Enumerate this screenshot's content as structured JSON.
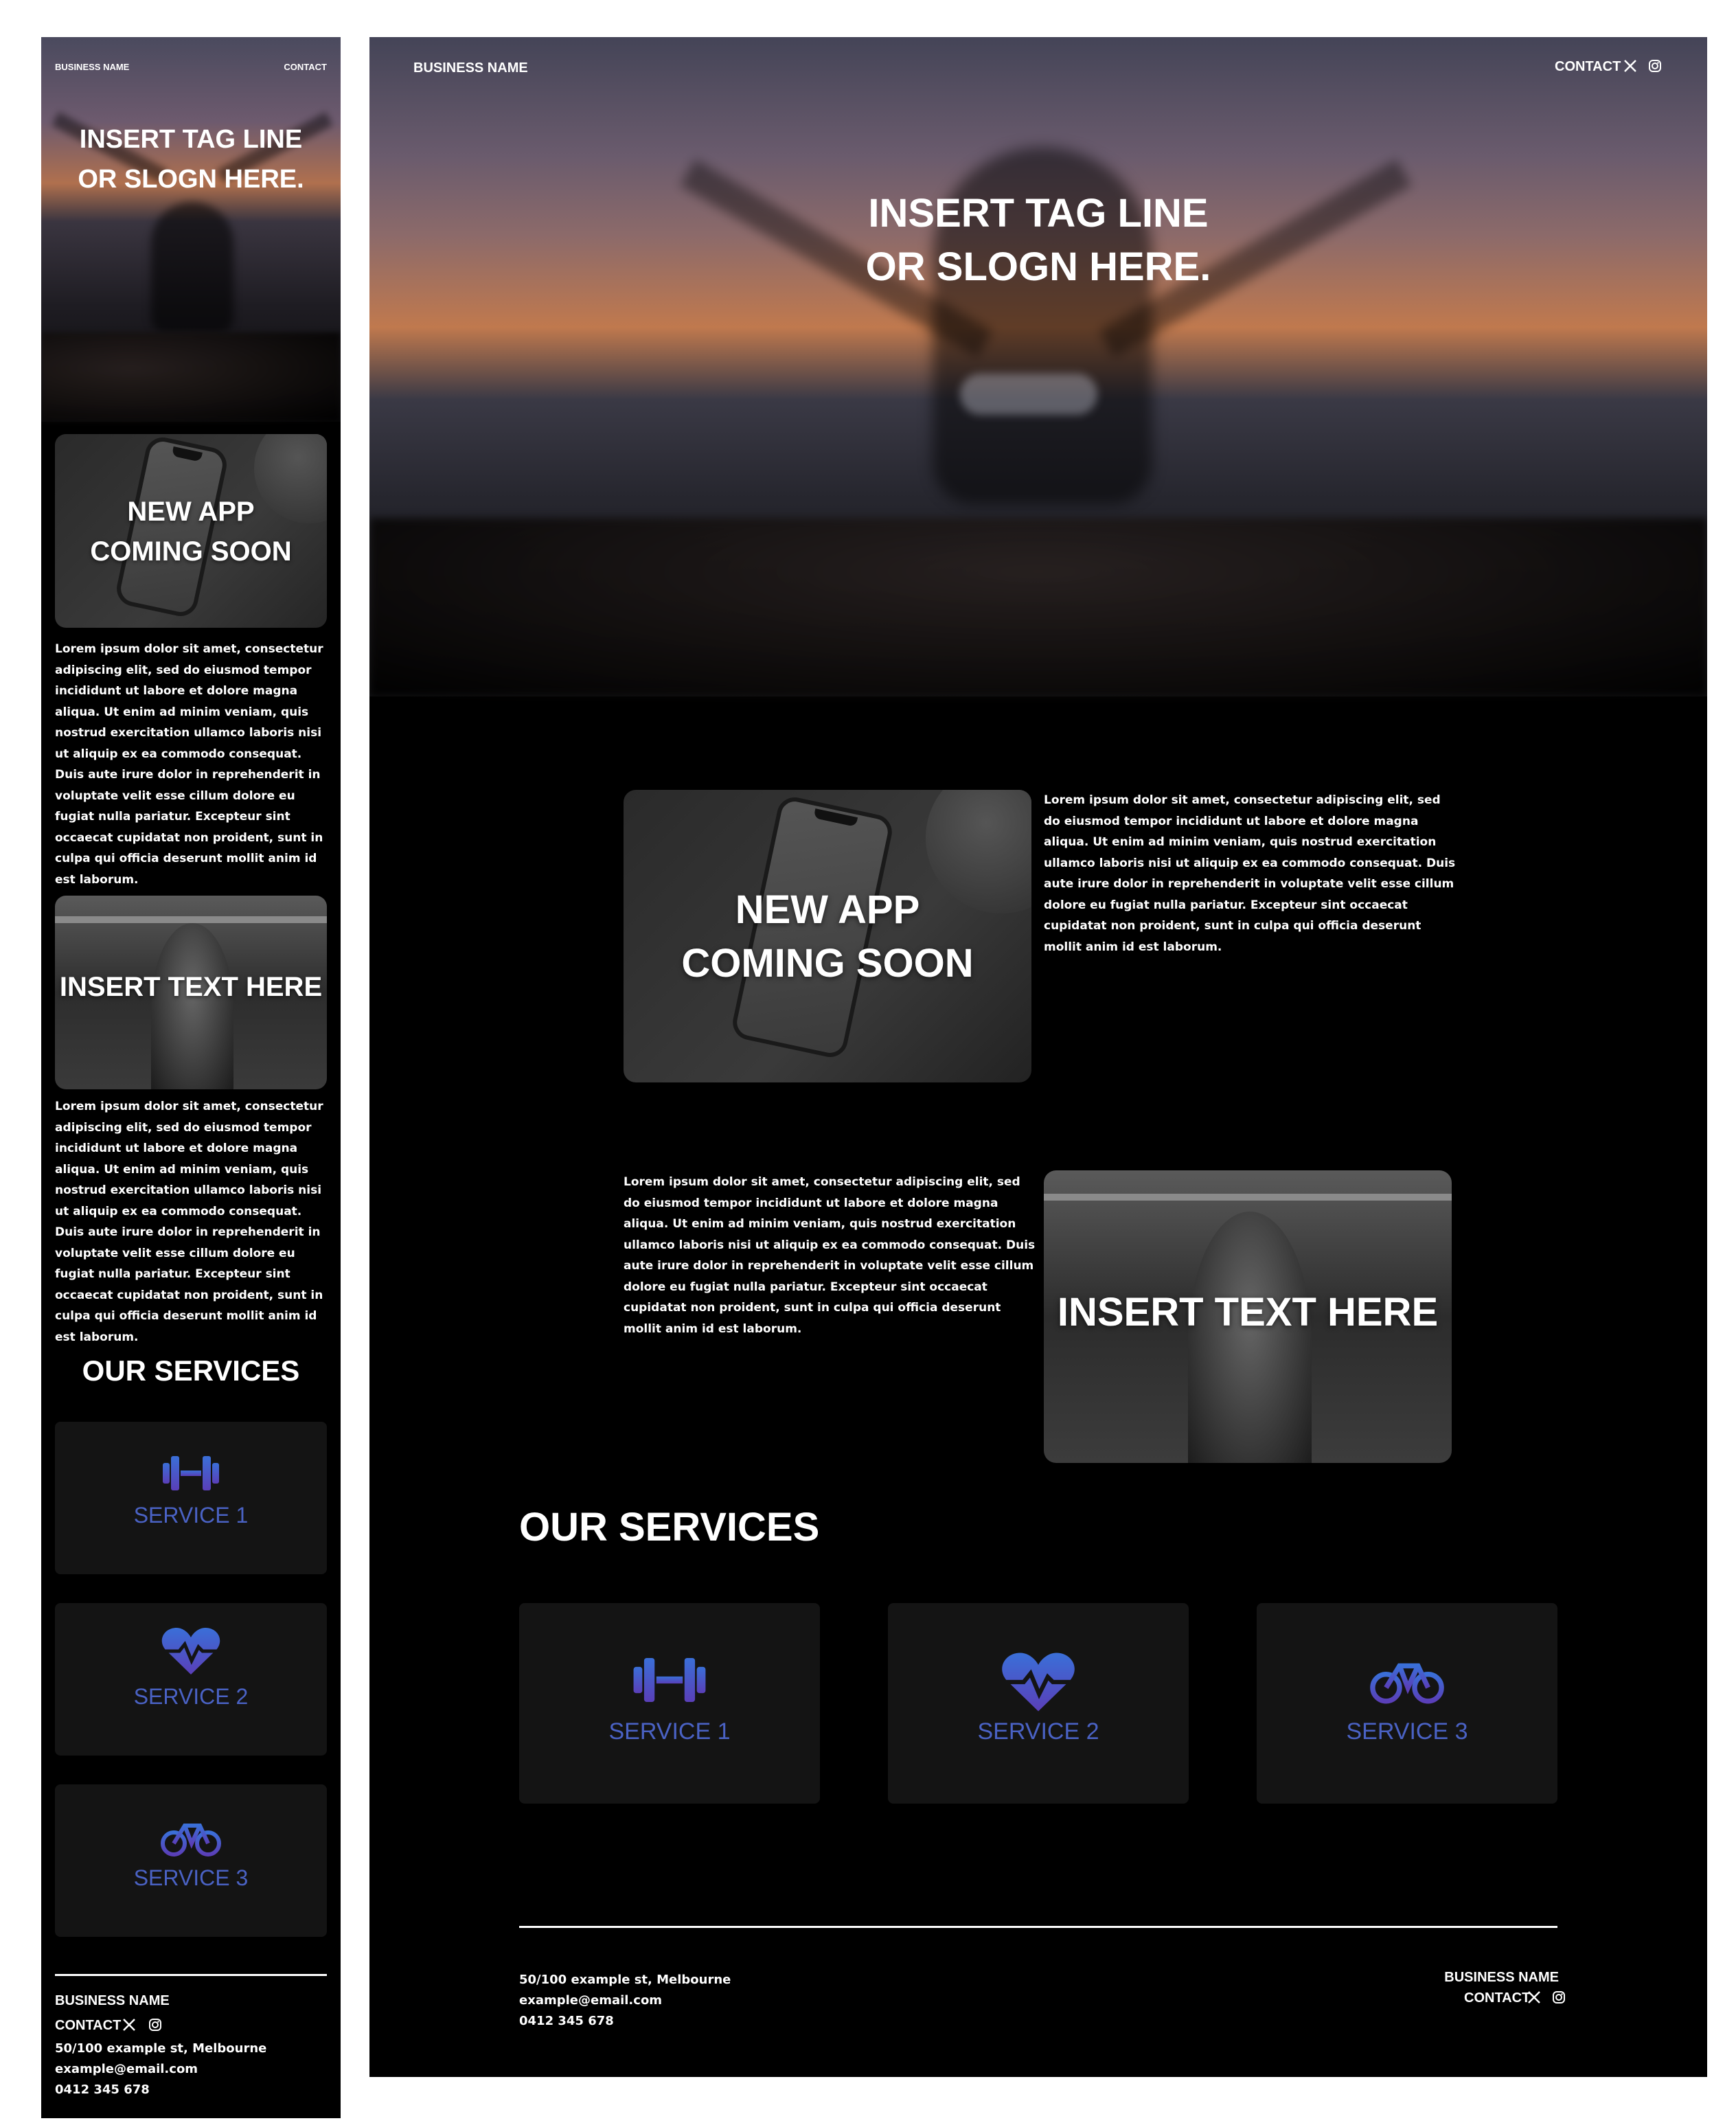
{
  "brand": {
    "name": "BUSINESS NAME",
    "contact_label": "CONTACT"
  },
  "hero": {
    "tagline_line1": "INSERT TAG LINE",
    "tagline_line2": "OR SLOGN HERE."
  },
  "features": {
    "app_title_line1": "NEW APP",
    "app_title_line2": "COMING SOON",
    "gym_title": "INSERT TEXT HERE",
    "para_desktop_1": "Lorem ipsum dolor sit amet, consectetur adipiscing elit, sed do eiusmod tempor incididunt ut labore et dolore magna aliqua. Ut enim ad minim veniam, quis nostrud exercitation ullamco laboris nisi ut aliquip ex ea commodo consequat. Duis aute irure dolor in reprehenderit in voluptate velit esse cillum dolore eu fugiat nulla pariatur. Excepteur sint occaecat cupidatat non proident, sunt in culpa qui officia deserunt mollit anim id est laborum.",
    "para_desktop_2": "Lorem ipsum dolor sit amet, consectetur adipiscing elit, sed do eiusmod tempor incididunt ut labore et dolore magna aliqua. Ut enim ad minim veniam, quis nostrud exercitation ullamco laboris nisi ut aliquip ex ea commodo consequat. Duis aute irure dolor in reprehenderit in voluptate velit esse cillum dolore eu fugiat nulla pariatur. Excepteur sint occaecat cupidatat non proident, sunt in culpa qui officia deserunt mollit anim id est laborum.",
    "para_mobile_1": "Lorem ipsum dolor sit amet, consectetur adipiscing elit, sed do eiusmod tempor incididunt ut labore et dolore magna aliqua. Ut enim ad minim veniam, quis nostrud exercitation ullamco laboris nisi ut aliquip ex ea commodo consequat. Duis aute irure dolor in reprehenderit in voluptate velit esse cillum dolore eu fugiat nulla pariatur. Excepteur sint occaecat cupidatat non proident, sunt in culpa qui officia deserunt mollit anim id est laborum.",
    "para_mobile_2": "Lorem ipsum dolor sit amet, consectetur adipiscing elit, sed do eiusmod tempor incididunt ut labore et dolore magna aliqua. Ut enim ad minim veniam, quis nostrud exercitation ullamco laboris nisi ut aliquip ex ea commodo consequat. Duis aute irure dolor in reprehenderit in voluptate velit esse cillum dolore eu fugiat nulla pariatur. Excepteur sint occaecat cupidatat non proident, sunt in culpa qui officia deserunt mollit anim id est laborum."
  },
  "services": {
    "title": "OUR SERVICES",
    "items": [
      {
        "label": "SERVICE 1",
        "icon": "dumbbell-icon"
      },
      {
        "label": "SERVICE 2",
        "icon": "heart-pulse-icon"
      },
      {
        "label": "SERVICE 3",
        "icon": "bicycle-icon"
      }
    ]
  },
  "footer": {
    "address": "50/100 example st, Melbourne",
    "email": "example@email.com",
    "phone": "0412 345 678"
  },
  "colors": {
    "background": "#000000",
    "card": "#141414",
    "accent_blue": "#3a6fd8",
    "accent_purple": "#5a3fb8",
    "service_label": "#4a62c4"
  }
}
